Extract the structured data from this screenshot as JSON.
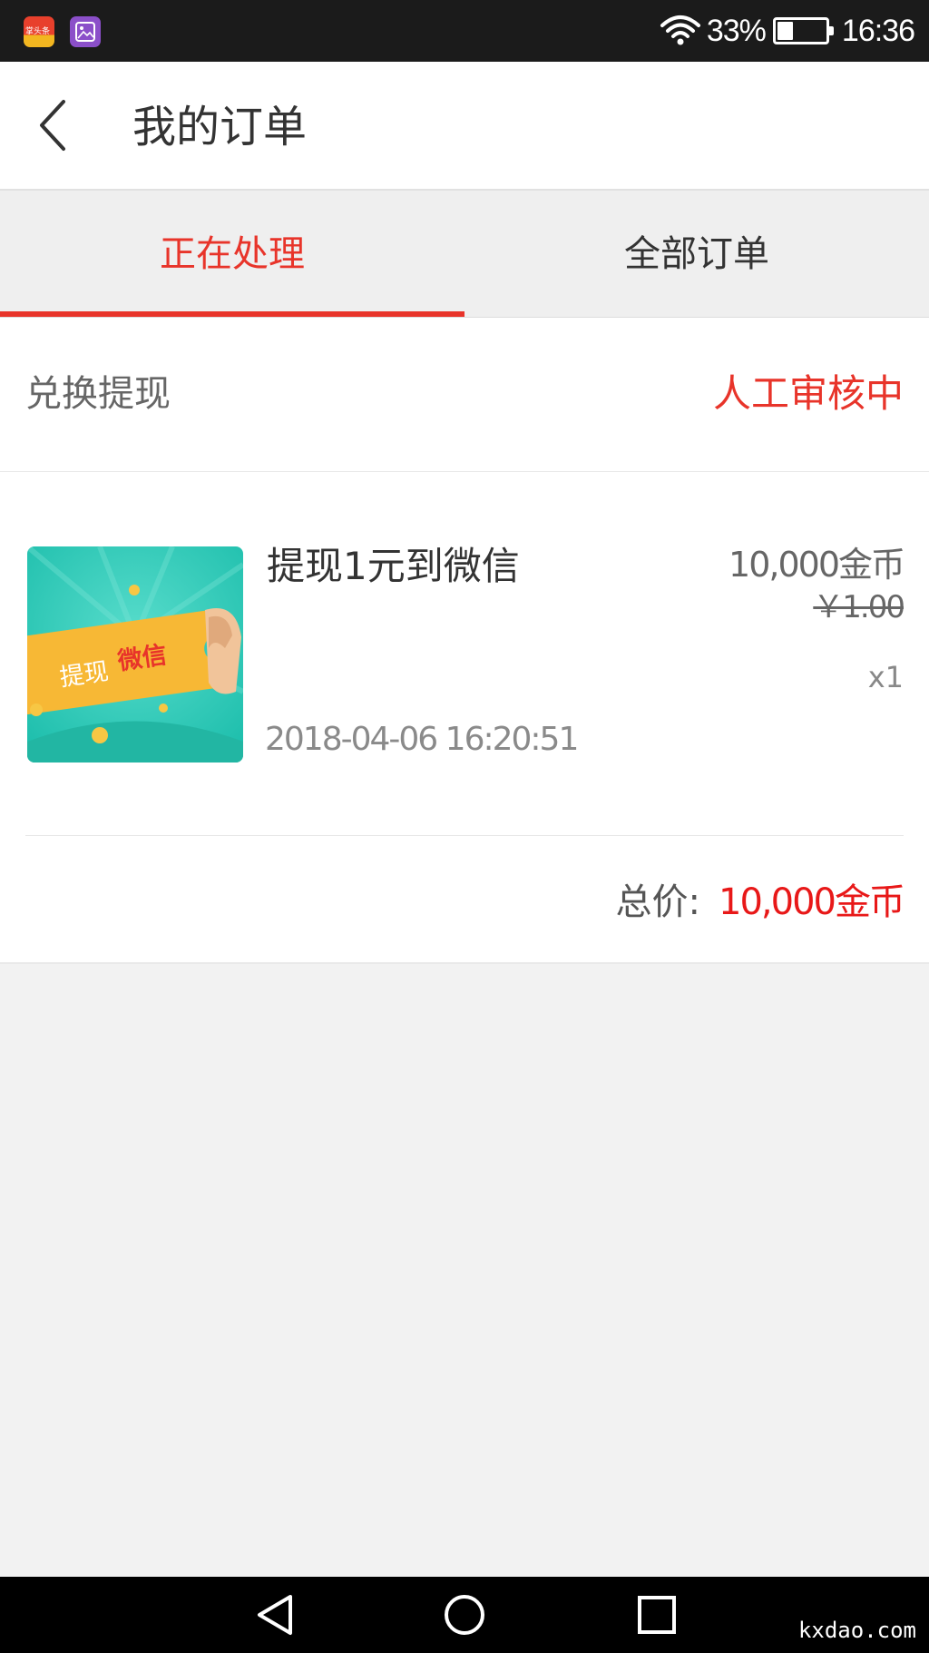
{
  "status_bar": {
    "app1_text": "掌头条",
    "battery_percent": "33%",
    "battery_level": 0.33,
    "time": "16:36"
  },
  "header": {
    "title": "我的订单",
    "back_icon": "chevron-left-icon"
  },
  "tabs": [
    {
      "label": "正在处理",
      "active": true
    },
    {
      "label": "全部订单",
      "active": false
    }
  ],
  "order": {
    "type": "兑换提现",
    "status": "人工审核中",
    "product": {
      "name": "提现1元到微信",
      "coins": "10,000金币",
      "original_price": "￥1.00",
      "quantity": "x1",
      "time": "2018-04-06 16:20:51",
      "thumb_text_white": "提现",
      "thumb_text_red": "微信"
    },
    "total_label": "总价:",
    "total_value": "10,000金币"
  },
  "nav": {
    "back": "nav-back-icon",
    "home": "nav-home-icon",
    "recent": "nav-recent-icon"
  },
  "watermark": "kxdao.com",
  "colors": {
    "accent_red": "#e8342a",
    "price_red": "#e81818",
    "thumb_teal": "#2ec9b4",
    "thumb_yellow": "#f7b835"
  }
}
